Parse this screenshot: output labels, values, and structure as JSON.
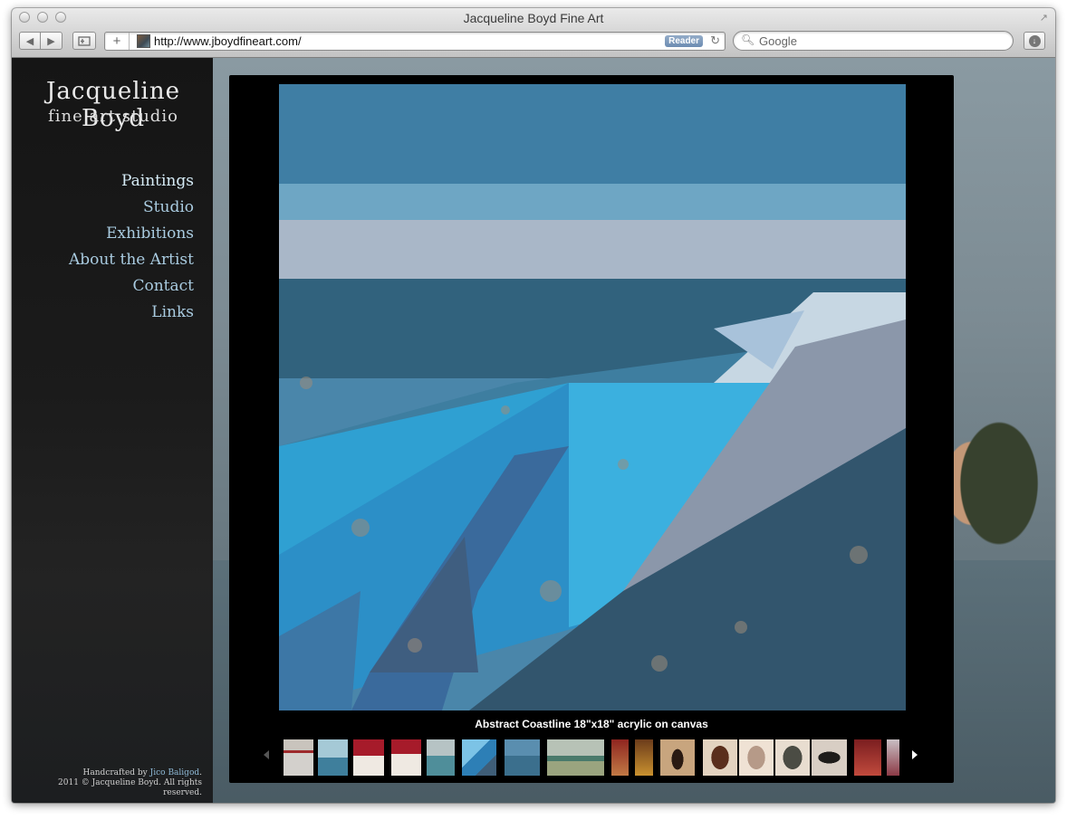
{
  "window": {
    "title": "Jacqueline Boyd Fine Art"
  },
  "toolbar": {
    "back_icon": "◀",
    "forward_icon": "▶",
    "address_url": "http://www.jboydfineart.com/",
    "reader_label": "Reader",
    "search_placeholder": "Google"
  },
  "site": {
    "logo_line1": "Jacqueline Boyd",
    "logo_line2": "fine art studio",
    "nav": [
      {
        "label": "Paintings",
        "active": true
      },
      {
        "label": "Studio",
        "active": false
      },
      {
        "label": "Exhibitions",
        "active": false
      },
      {
        "label": "About the Artist",
        "active": false
      },
      {
        "label": "Contact",
        "active": false
      },
      {
        "label": "Links",
        "active": false
      }
    ],
    "footer": {
      "handcrafted_prefix": "Handcrafted by ",
      "handcrafted_link": "Jico Baligod",
      "handcrafted_suffix": ".",
      "copyright": "2011 © Jacqueline Boyd. All rights reserved."
    }
  },
  "gallery": {
    "caption": "Abstract Coastline 18\"x18\" acrylic on canvas",
    "thumbnail_count": 16
  },
  "colors": {
    "nav_link": "#a9cbe0",
    "nav_active": "#d6ecf7",
    "panel_bg": "#000000"
  }
}
